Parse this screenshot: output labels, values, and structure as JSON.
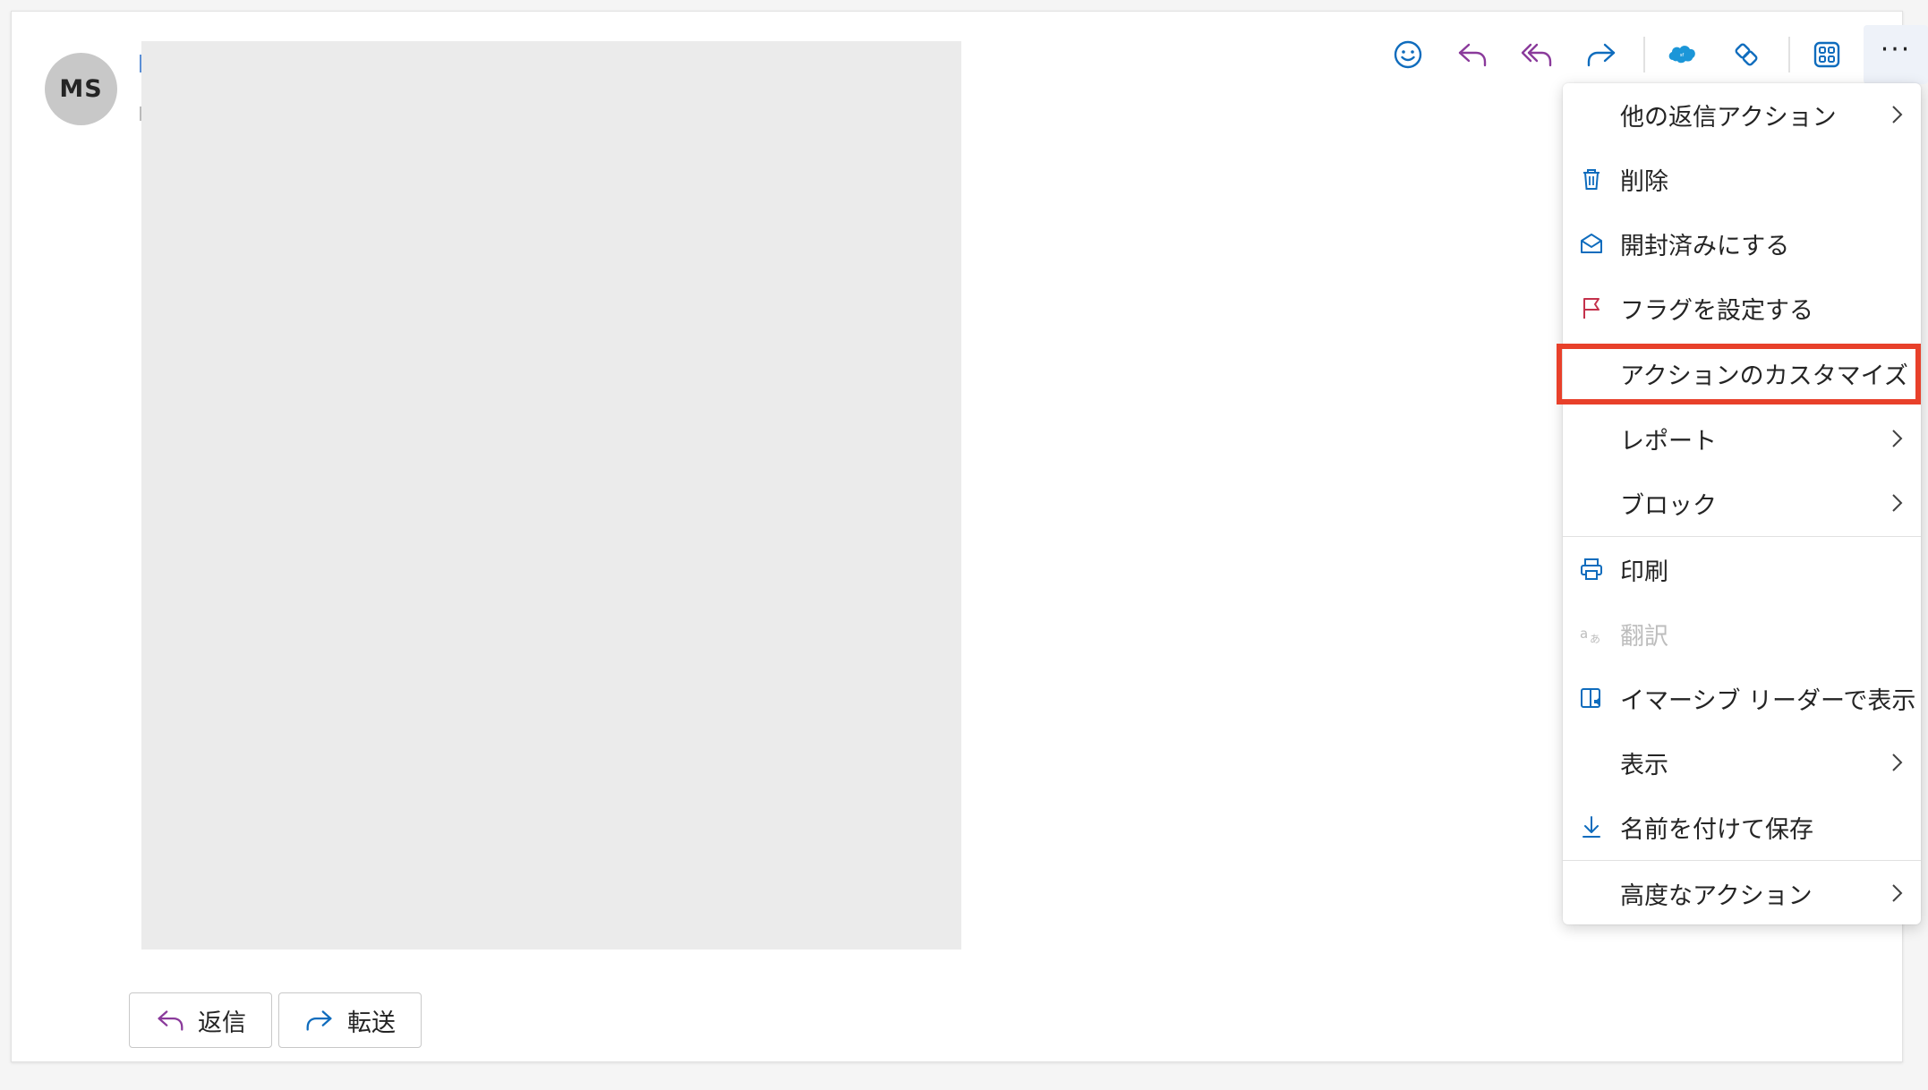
{
  "sender": {
    "initials": "MS"
  },
  "toolbar": {
    "icons": [
      "emoji-icon",
      "reply-icon",
      "reply-all-icon",
      "forward-icon",
      "salesforce-icon",
      "addin-icon",
      "apps-icon",
      "more-icon"
    ]
  },
  "menu": {
    "items": [
      {
        "label": "他の返信アクション",
        "icon": "",
        "submenu": true
      },
      {
        "label": "削除",
        "icon": "trash-icon",
        "submenu": false
      },
      {
        "label": "開封済みにする",
        "icon": "envelope-open-icon",
        "submenu": false
      },
      {
        "label": "フラグを設定する",
        "icon": "flag-icon",
        "submenu": false
      },
      {
        "label": "アクションのカスタマイズ",
        "icon": "",
        "submenu": false,
        "highlighted": true
      },
      {
        "label": "レポート",
        "icon": "",
        "submenu": true
      },
      {
        "label": "ブロック",
        "icon": "",
        "submenu": true
      },
      {
        "label": "印刷",
        "icon": "printer-icon",
        "submenu": false
      },
      {
        "label": "翻訳",
        "icon": "translate-icon",
        "submenu": false,
        "disabled": true
      },
      {
        "label": "イマーシブ リーダーで表示",
        "icon": "immersive-reader-icon",
        "submenu": false
      },
      {
        "label": "表示",
        "icon": "",
        "submenu": true
      },
      {
        "label": "名前を付けて保存",
        "icon": "download-icon",
        "submenu": false
      },
      {
        "label": "高度なアクション",
        "icon": "",
        "submenu": true
      }
    ]
  },
  "footer": {
    "reply_label": "返信",
    "forward_label": "転送"
  },
  "colors": {
    "accent": "#0f6cbd",
    "reply_purple": "#8a3a9b",
    "flag_red": "#c4314b",
    "highlight": "#e8402a"
  }
}
